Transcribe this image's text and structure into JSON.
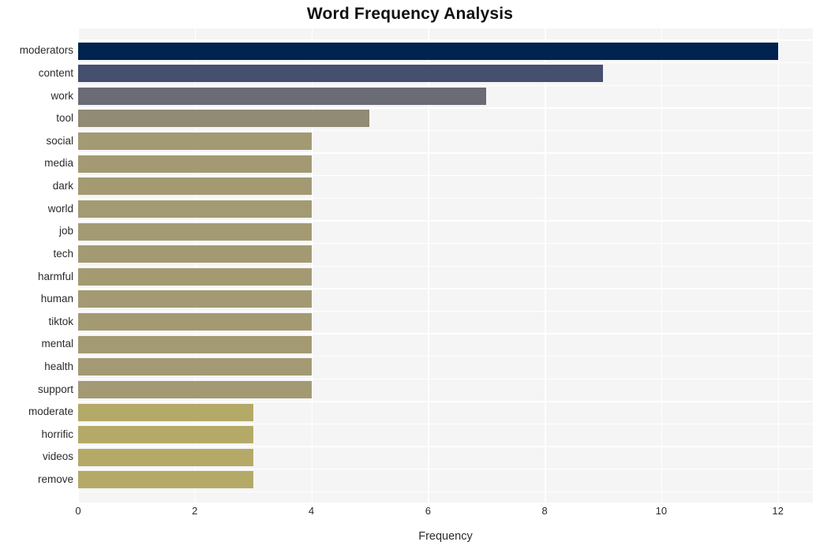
{
  "chart_data": {
    "type": "bar",
    "orientation": "horizontal",
    "title": "Word Frequency Analysis",
    "xlabel": "Frequency",
    "ylabel": "",
    "categories": [
      "moderators",
      "content",
      "work",
      "tool",
      "social",
      "media",
      "dark",
      "world",
      "job",
      "tech",
      "harmful",
      "human",
      "tiktok",
      "mental",
      "health",
      "support",
      "moderate",
      "horrific",
      "videos",
      "remove"
    ],
    "values": [
      12,
      9,
      7,
      5,
      4,
      4,
      4,
      4,
      4,
      4,
      4,
      4,
      4,
      4,
      4,
      4,
      3,
      3,
      3,
      3
    ],
    "bar_colors": [
      "#00234f",
      "#454f6e",
      "#6a6b75",
      "#918a74",
      "#a39a73",
      "#a39a73",
      "#a39a73",
      "#a39a73",
      "#a39a73",
      "#a39a73",
      "#a39a73",
      "#a39a73",
      "#a39a73",
      "#a39a73",
      "#a39a73",
      "#a39a73",
      "#b5a968",
      "#b5a968",
      "#b5a968",
      "#b5a968"
    ],
    "xlim": [
      0,
      12.6
    ],
    "xticks": [
      0,
      2,
      4,
      6,
      8,
      10,
      12
    ],
    "xtick_labels": [
      "0",
      "2",
      "4",
      "6",
      "8",
      "10",
      "12"
    ],
    "grid": true,
    "grid_color": "#ffffff",
    "plot_background": "#f5f5f6",
    "figure_background": "#ffffff",
    "legend": null
  }
}
